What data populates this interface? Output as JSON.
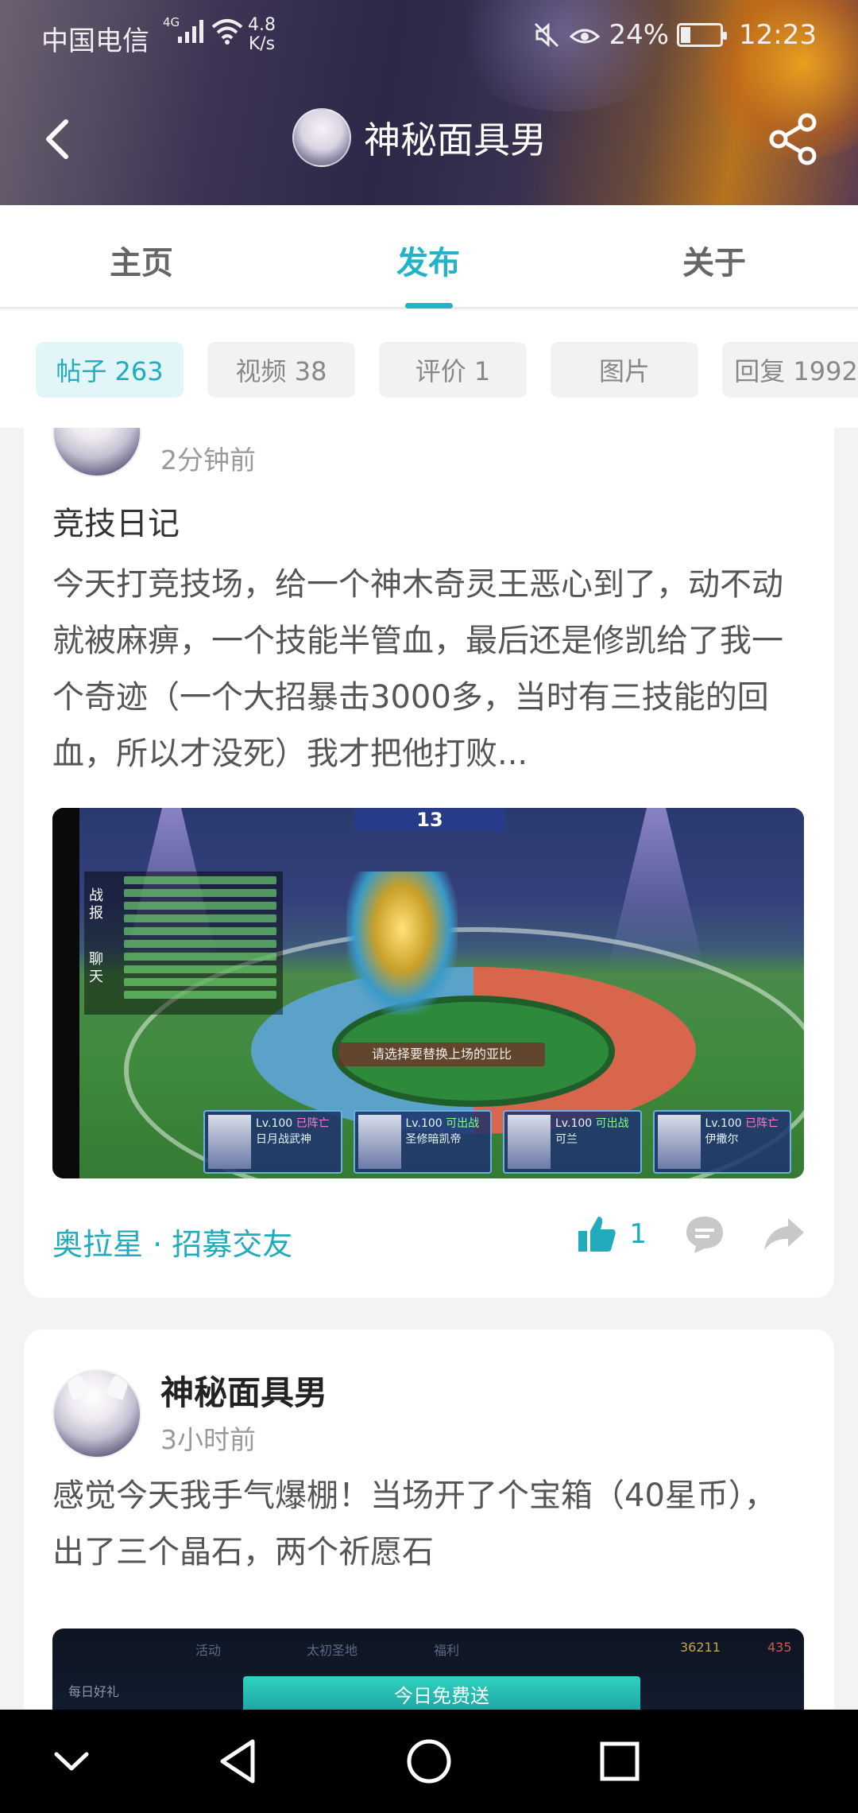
{
  "status_bar": {
    "carrier": "中国电信",
    "network": "4G",
    "speed_value": "4.8",
    "speed_unit": "K/s",
    "battery": "24%",
    "battery_level": 0.24,
    "time": "12:23"
  },
  "header": {
    "title": "神秘面具男"
  },
  "tabs": [
    {
      "label": "主页",
      "active": false
    },
    {
      "label": "发布",
      "active": true
    },
    {
      "label": "关于",
      "active": false
    }
  ],
  "filters": [
    {
      "label": "帖子 263",
      "active": true
    },
    {
      "label": "视频 38",
      "active": false
    },
    {
      "label": "评价 1",
      "active": false
    },
    {
      "label": "图片",
      "active": false
    },
    {
      "label": "回复 1992",
      "active": false
    }
  ],
  "posts": [
    {
      "time": "2分钟前",
      "title": "竞技日记",
      "body": "今天打竞技场，给一个神木奇灵王恶心到了，动不动就被麻痹，一个技能半管血，最后还是修凯给了我一个奇迹（一个大招暴击3000多，当时有三技能的回血，所以才没死）我才把他打败...",
      "tag": "奥拉星 · 招募交友",
      "likes": "1",
      "image": {
        "round_number": "13",
        "chat_tab_1": "战报",
        "chat_tab_2": "聊天",
        "prompt": "请选择要替换上场的亚比",
        "slots": [
          {
            "level": "Lv.100",
            "status": "已阵亡",
            "name": "日月战武神"
          },
          {
            "level": "Lv.100",
            "status": "可出战",
            "name": "圣修暗凯帝"
          },
          {
            "level": "Lv.100",
            "status": "可出战",
            "name": "可兰"
          },
          {
            "level": "Lv.100",
            "status": "已阵亡",
            "name": "伊撒尔"
          }
        ]
      }
    },
    {
      "author": "神秘面具男",
      "time": "3小时前",
      "body": "感觉今天我手气爆棚！当场开了个宝箱（40星币），出了三个晶石，两个祈愿石",
      "image": {
        "tabs": [
          "活动",
          "太初圣地",
          "福利"
        ],
        "coins": "36211",
        "gems": "435",
        "side_label": "每日好礼",
        "button": "今日免费送"
      }
    }
  ],
  "colors": {
    "accent": "#22b4c6",
    "tag": "#22aabd",
    "chip_active_bg": "#e2f6f9"
  },
  "icons": {
    "back": "back-arrow-icon",
    "share": "share-icon",
    "like": "thumbs-up-icon",
    "comment": "comment-icon",
    "forward": "forward-icon",
    "nav_down": "chevron-down-icon",
    "nav_back": "triangle-back-icon",
    "nav_home": "circle-home-icon",
    "nav_recent": "square-recent-icon"
  }
}
